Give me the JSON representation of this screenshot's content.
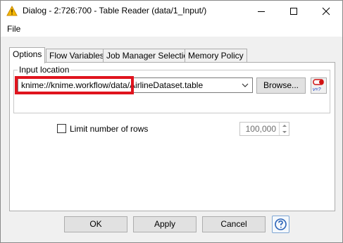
{
  "window": {
    "title": "Dialog - 2:726:700 - Table Reader (data/1_Input/)"
  },
  "menubar": {
    "items": [
      "File"
    ]
  },
  "tabs": [
    {
      "label": "Options",
      "active": true
    },
    {
      "label": "Flow Variables",
      "active": false
    },
    {
      "label": "Job Manager Selection",
      "active": false
    },
    {
      "label": "Memory Policy",
      "active": false
    }
  ],
  "input_location": {
    "group_label": "Input location",
    "value": "knime://knime.workflow/data/AirlineDataset.table",
    "browse_label": "Browse...",
    "flow_variable_icon_text": "v=?"
  },
  "limit_rows": {
    "label": "Limit number of rows",
    "checked": false,
    "value": "100,000"
  },
  "footer": {
    "ok_label": "OK",
    "apply_label": "Apply",
    "cancel_label": "Cancel"
  },
  "colors": {
    "highlight": "#e0141e",
    "app_icon": "#f5b800"
  }
}
